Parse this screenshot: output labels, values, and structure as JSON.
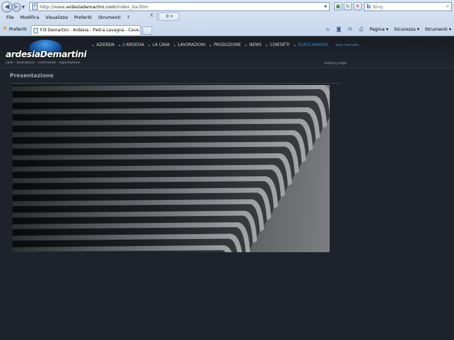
{
  "browser": {
    "address": {
      "prefix": "http://www.",
      "host": "ardesiademartini.com",
      "path": "/index_ita.htm"
    },
    "search": {
      "engine": "Bing",
      "placeholder": "Bing"
    },
    "menu": [
      "File",
      "Modifica",
      "Visualizza",
      "Preferiti",
      "Strumenti",
      "?"
    ],
    "favorites_label": "Preferiti",
    "tab_title": "F.lli Demartini - Ardesia - Pietra Lavagna - Cave, Lavo...",
    "close_tab": "X",
    "commands": [
      "Pagina",
      "Sicurezza",
      "Strumenti"
    ]
  },
  "site": {
    "logo": {
      "brand": "ardesiaDemartini",
      "tagline": "cave - lavorazione - commercio - esportazione"
    },
    "nav": [
      "AZIENDA",
      "L'ARDESIA",
      "LA CAVA",
      "LAVORAZIONI",
      "PRODUZIONE",
      "NEWS",
      "CONTATTI",
      "EUROLAVAGNE"
    ],
    "area_riservata": "area riservata",
    "loading": "loading page",
    "section_title": "Presentazione"
  },
  "colors": {
    "page_bg": "#1e222b",
    "nav_text": "#d5d9e0",
    "nav_highlight": "#2e8fd9",
    "chrome_bg": "#dbe6f4"
  }
}
